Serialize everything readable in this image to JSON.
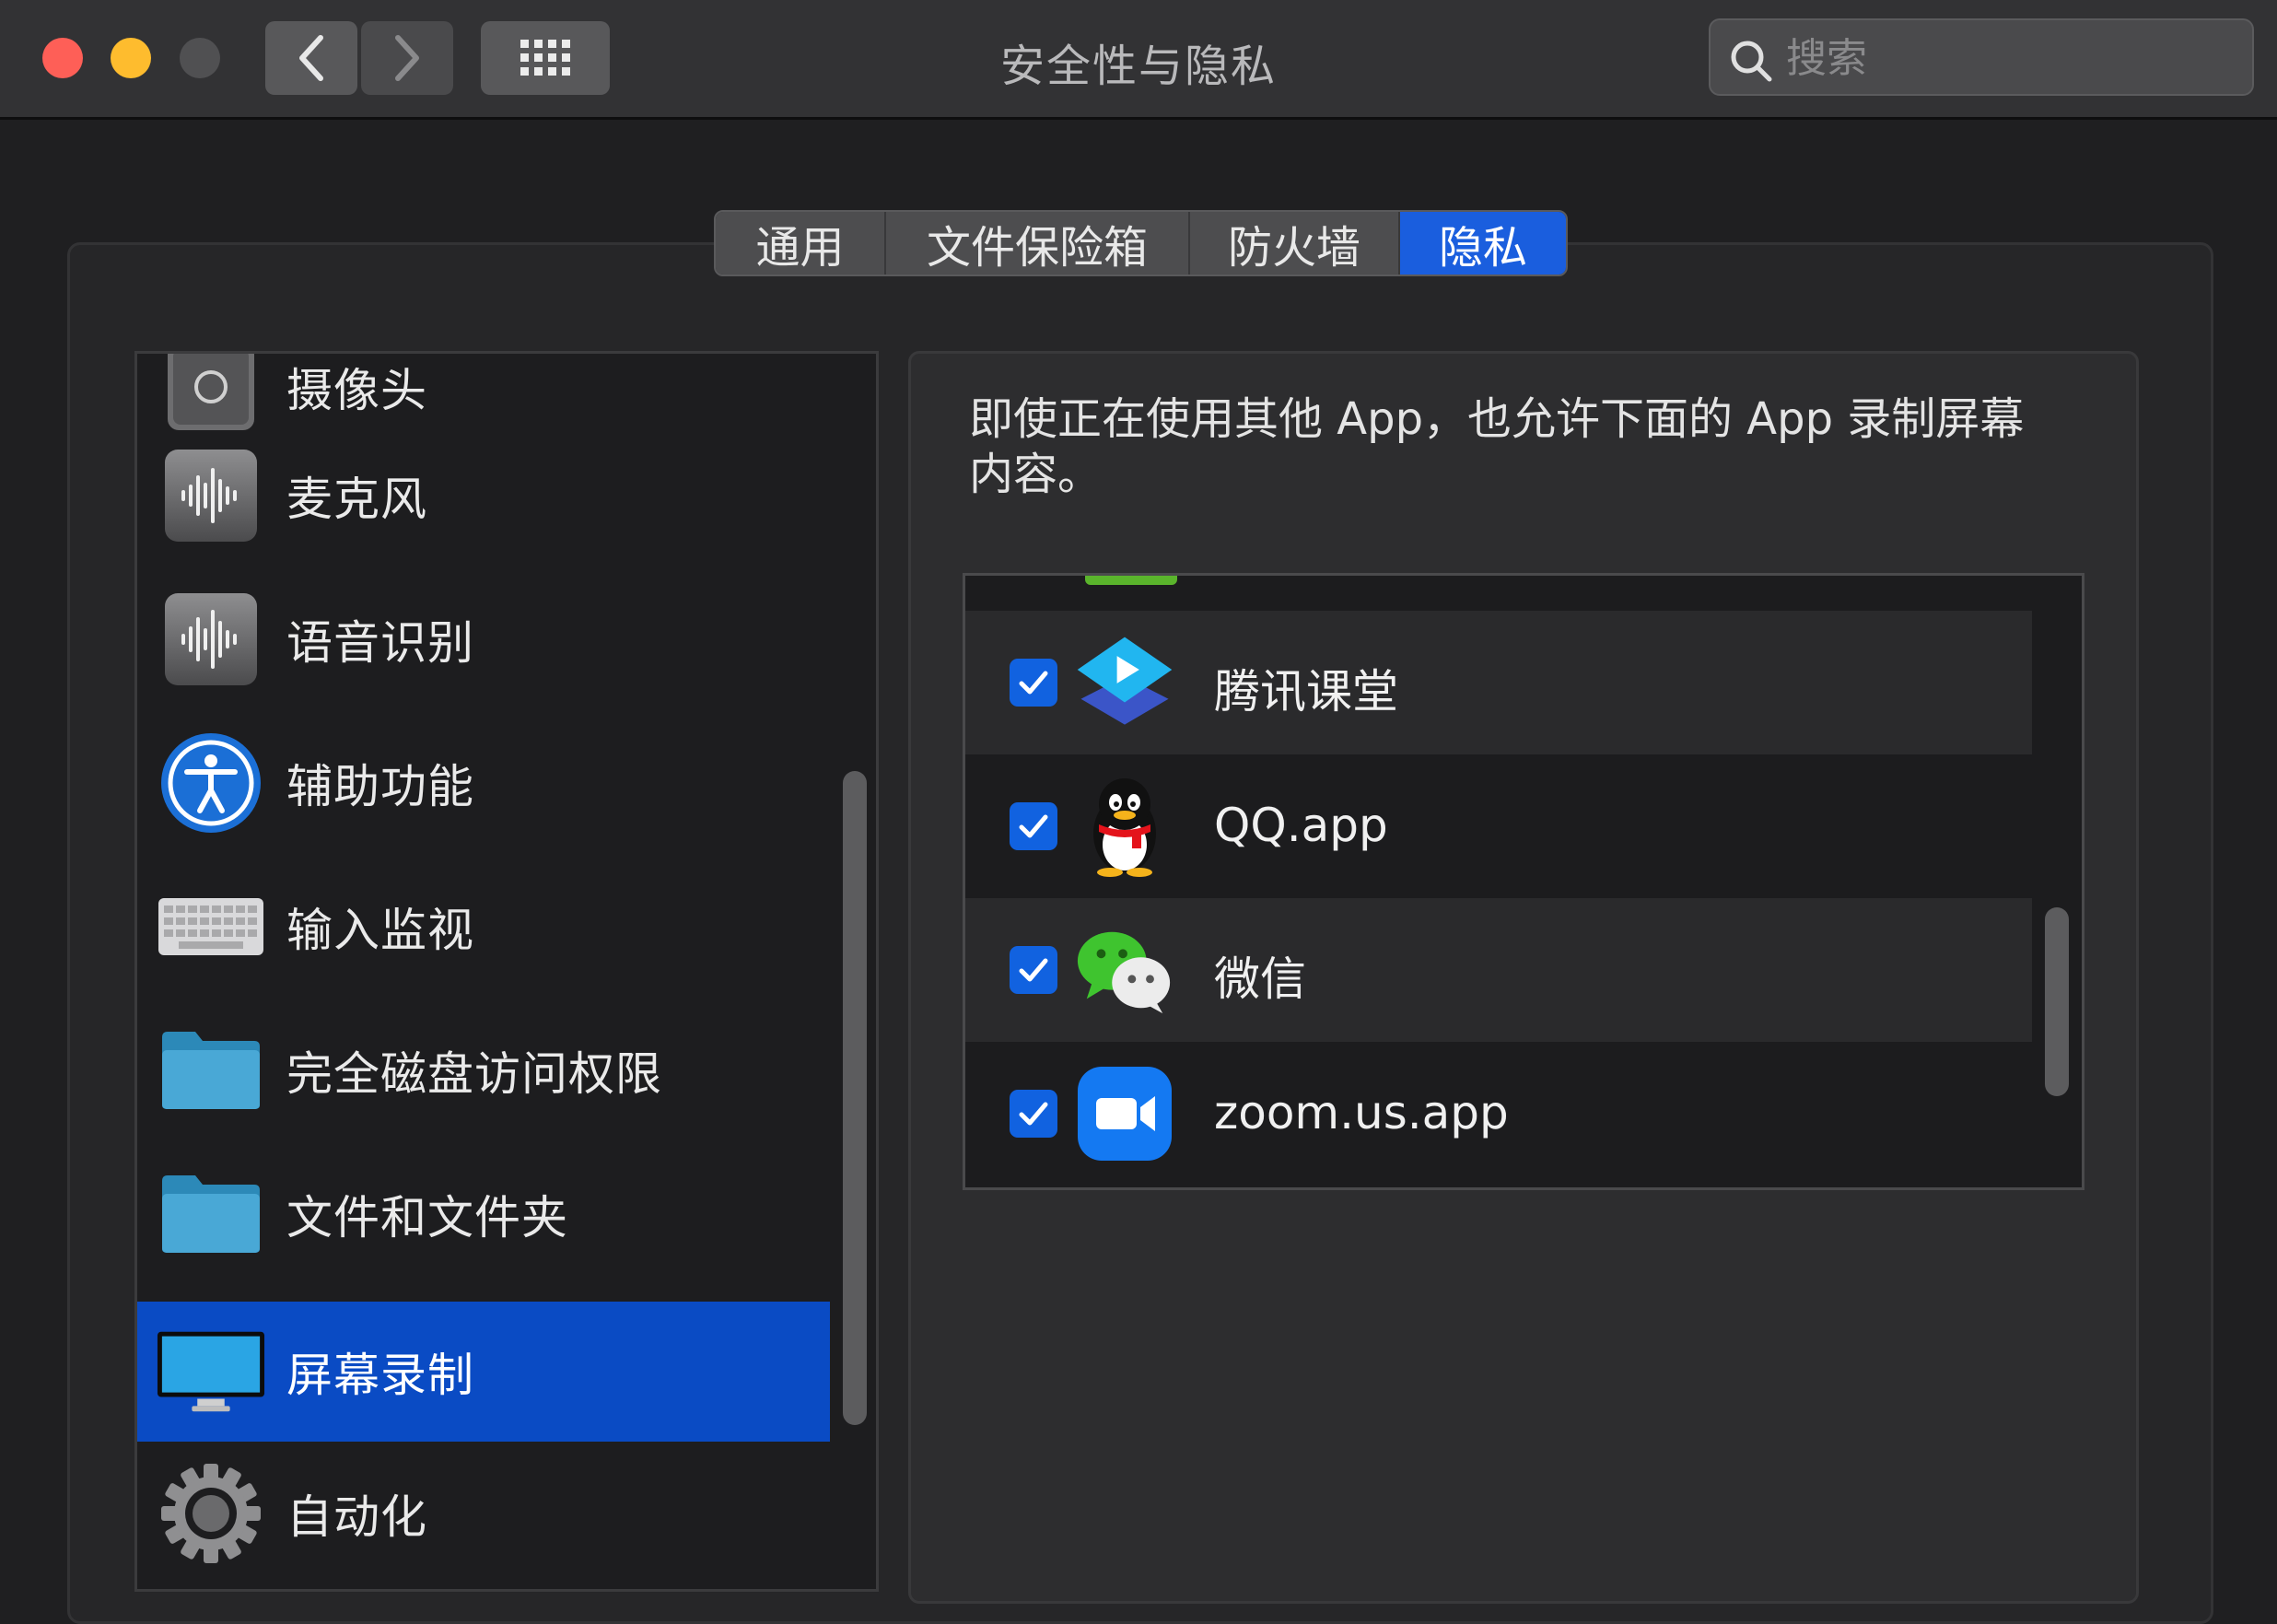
{
  "window": {
    "title": "安全性与隐私",
    "search_placeholder": "搜索"
  },
  "tabs": [
    {
      "label": "通用",
      "active": false
    },
    {
      "label": "文件保险箱",
      "active": false
    },
    {
      "label": "防火墙",
      "active": false
    },
    {
      "label": "隐私",
      "active": true
    }
  ],
  "sidebar": {
    "items": [
      {
        "label": "摄像头",
        "icon": "camera-icon"
      },
      {
        "label": "麦克风",
        "icon": "microphone-icon"
      },
      {
        "label": "语音识别",
        "icon": "speech-recognition-icon"
      },
      {
        "label": "辅助功能",
        "icon": "accessibility-icon"
      },
      {
        "label": "输入监视",
        "icon": "keyboard-icon"
      },
      {
        "label": "完全磁盘访问权限",
        "icon": "folder-icon"
      },
      {
        "label": "文件和文件夹",
        "icon": "folder-icon"
      },
      {
        "label": "屏幕录制",
        "icon": "display-icon",
        "selected": true
      },
      {
        "label": "自动化",
        "icon": "gear-icon"
      }
    ]
  },
  "detail": {
    "description_line1": "即使正在使用其他 App，也允许下面的 App 录制屏幕",
    "description_line2": "内容。",
    "apps": [
      {
        "name": "腾讯课堂",
        "checked": true,
        "icon": "tencent-classroom-icon"
      },
      {
        "name": "QQ.app",
        "checked": true,
        "icon": "qq-penguin-icon"
      },
      {
        "name": "微信",
        "checked": true,
        "icon": "wechat-icon"
      },
      {
        "name": "zoom.us.app",
        "checked": true,
        "icon": "zoom-icon"
      }
    ]
  },
  "colors": {
    "accent": "#1a5ede",
    "selection": "#0a4bc4",
    "checkbox": "#1162e0",
    "close": "#fe5f57",
    "minimize": "#febc2e"
  }
}
